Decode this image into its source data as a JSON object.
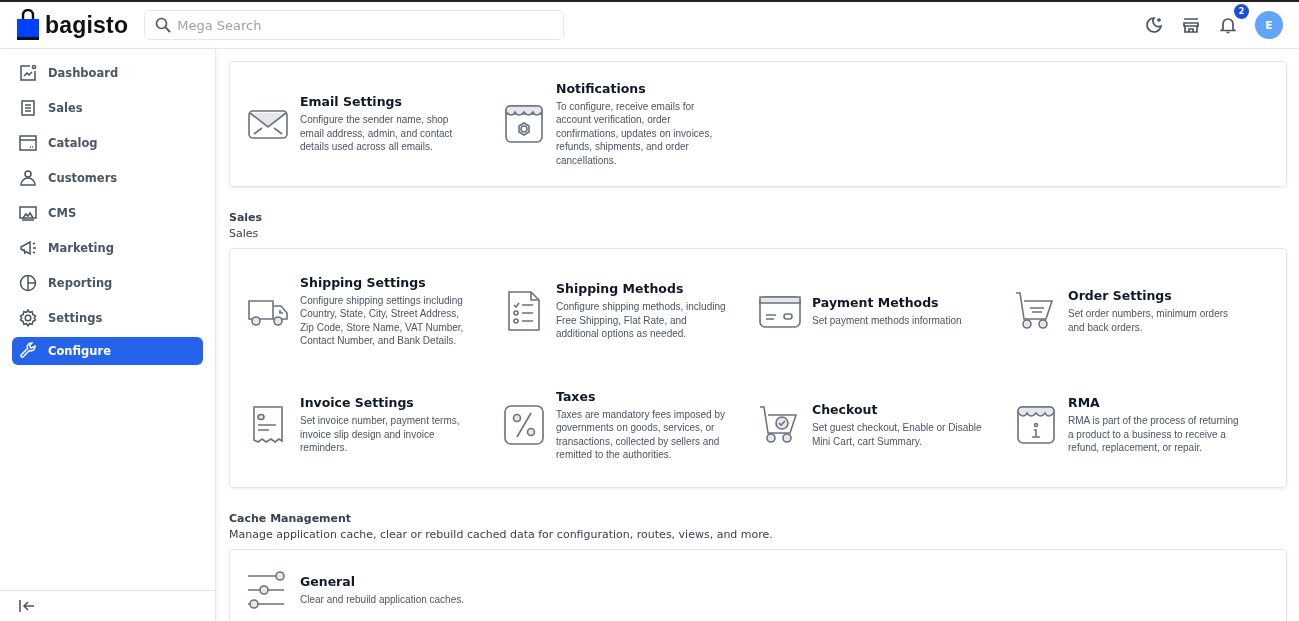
{
  "header": {
    "logo": "bagisto",
    "search": {
      "placeholder": "Mega Search"
    },
    "notifications_count": "2",
    "avatar": "E"
  },
  "sidebar": {
    "items": [
      {
        "label": "Dashboard",
        "selected": false
      },
      {
        "label": "Sales",
        "selected": false
      },
      {
        "label": "Catalog",
        "selected": false
      },
      {
        "label": "Customers",
        "selected": false
      },
      {
        "label": "CMS",
        "selected": false
      },
      {
        "label": "Marketing",
        "selected": false
      },
      {
        "label": "Reporting",
        "selected": false
      },
      {
        "label": "Settings",
        "selected": false
      },
      {
        "label": "Configure",
        "selected": true
      }
    ]
  },
  "sections": [
    {
      "items": [
        {
          "title": "Email Settings",
          "description": "Configure the sender name, shop email address, admin, and contact details used across all emails."
        },
        {
          "title": "Notifications",
          "description": "To configure, receive emails for account verification, order confirmations, updates on invoices, refunds, shipments, and order cancellations."
        }
      ]
    },
    {
      "title": "Sales",
      "subtitle": "Sales",
      "items": [
        {
          "title": "Shipping Settings",
          "description": "Configure shipping settings including Country, State, City, Street Address, Zip Code, Store Name, VAT Number, Contact Number, and Bank Details."
        },
        {
          "title": "Shipping Methods",
          "description": "Configure shipping methods, including Free Shipping, Flat Rate, and additional options as needed."
        },
        {
          "title": "Payment Methods",
          "description": "Set payment methods information"
        },
        {
          "title": "Order Settings",
          "description": "Set order numbers, minimum orders and back orders."
        },
        {
          "title": "Invoice Settings",
          "description": "Set invoice number, payment terms, invoice slip design and invoice reminders."
        },
        {
          "title": "Taxes",
          "description": "Taxes are mandatory fees imposed by governments on goods, services, or transactions, collected by sellers and remitted to the authorities."
        },
        {
          "title": "Checkout",
          "description": "Set guest checkout, Enable or Disable Mini Cart, cart Summary."
        },
        {
          "title": "RMA",
          "description": "RMA is part of the process of returning a product to a business to receive a refund, replacement, or repair."
        }
      ]
    },
    {
      "title": "Cache Management",
      "subtitle": "Manage application cache, clear or rebuild cached data for configuration, routes, views, and more.",
      "items": [
        {
          "title": "General",
          "description": "Clear and rebuild application caches."
        }
      ]
    }
  ]
}
